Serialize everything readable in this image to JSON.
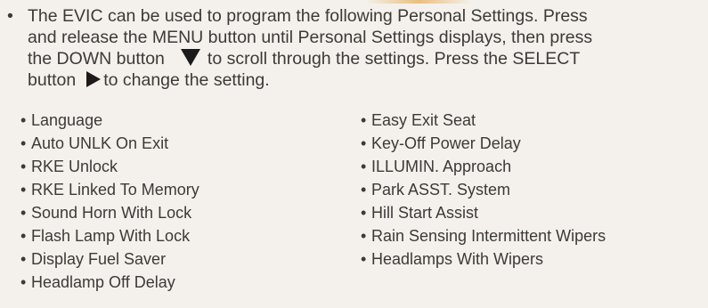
{
  "intro": {
    "bullet": "•",
    "line1": "The EVIC can be used to program the following Personal Settings. Press",
    "line2": "and release the MENU button until Personal Settings displays, then press",
    "line3a": "the DOWN button",
    "line3b": "to scroll through the settings. Press the SELECT",
    "line4a": "button",
    "line4b": "to change the setting."
  },
  "icons": {
    "down": "down-arrow-triangle-icon",
    "select": "right-arrow-triangle-icon"
  },
  "settings_left": [
    "Language",
    "Auto UNLK On Exit",
    "RKE Unlock",
    "RKE Linked To Memory",
    "Sound Horn With Lock",
    "Flash Lamp With Lock",
    "Display Fuel Saver",
    "Headlamp Off Delay"
  ],
  "settings_right": [
    "Easy Exit Seat",
    "Key-Off Power Delay",
    "ILLUMIN. Approach",
    "Park ASST. System",
    "Hill Start Assist",
    "Rain Sensing Intermittent Wipers",
    "Headlamps With Wipers"
  ],
  "list_bullet": "•"
}
